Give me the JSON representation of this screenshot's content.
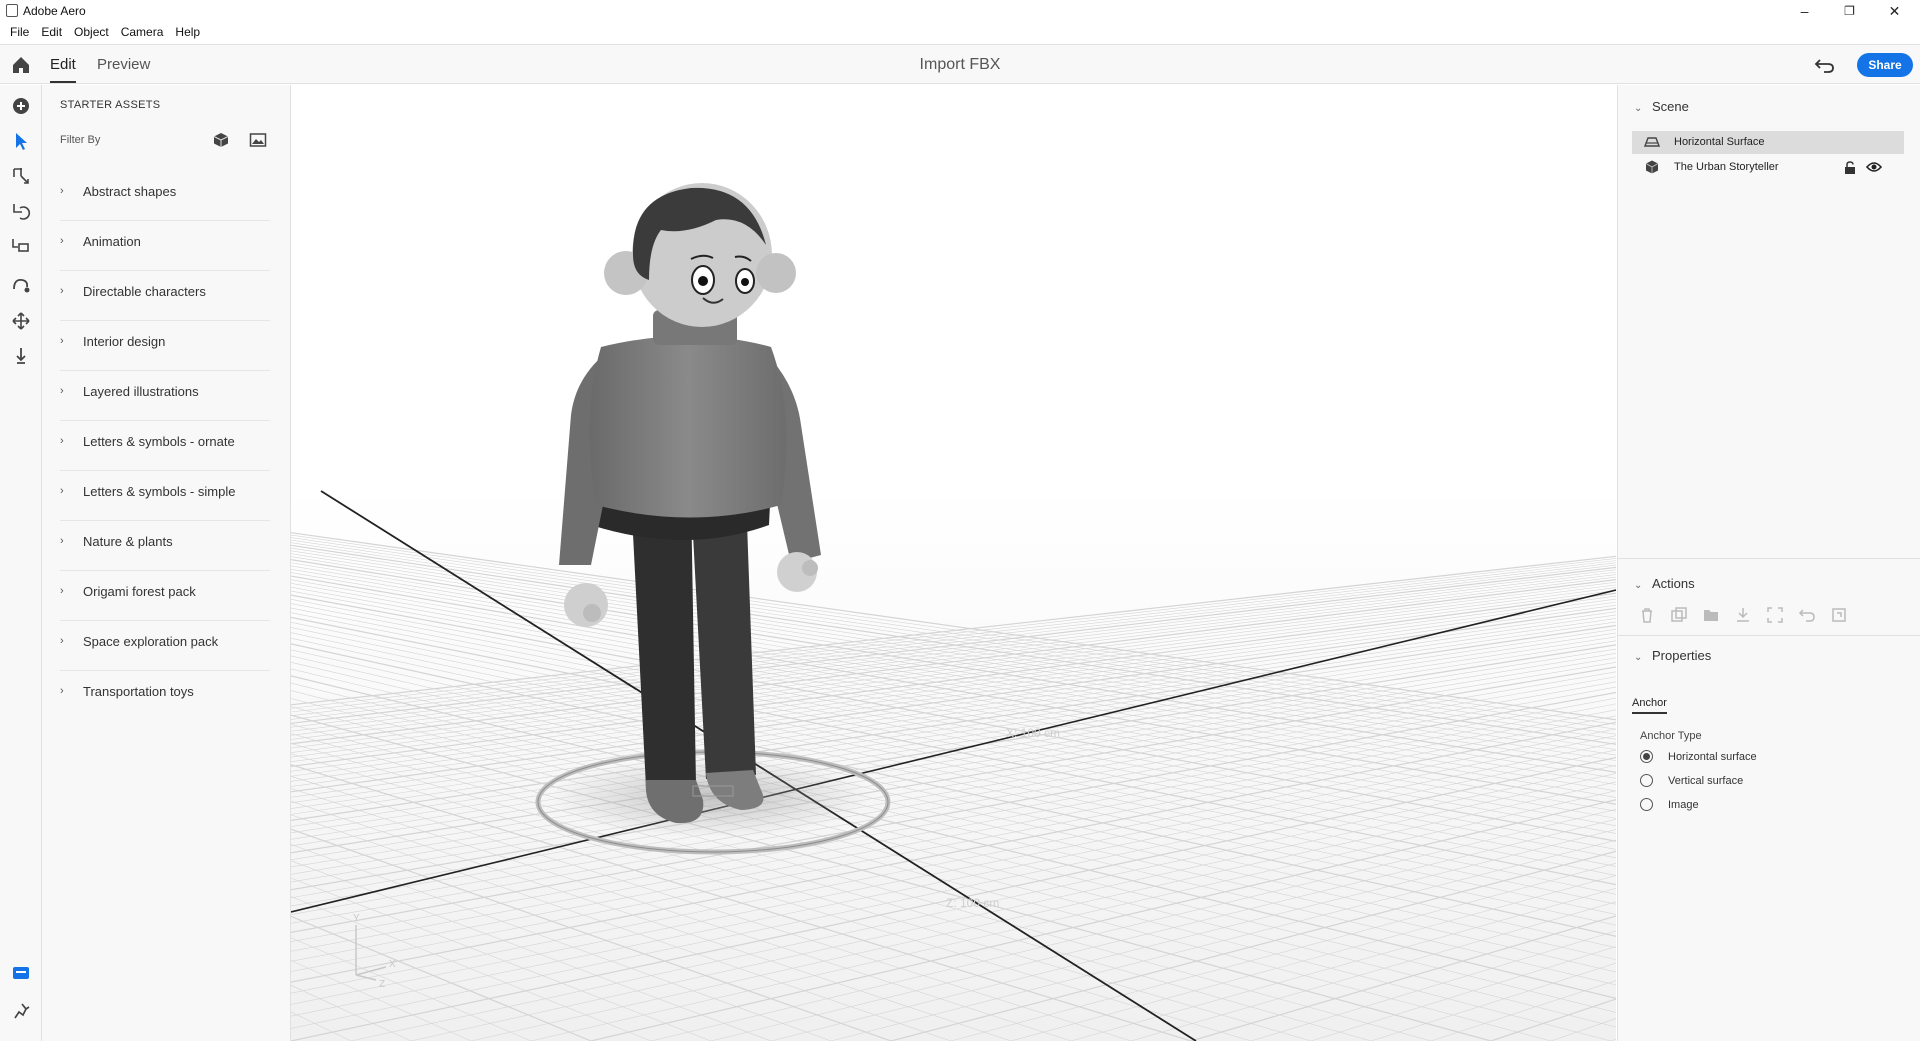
{
  "window": {
    "title": "Adobe Aero",
    "controls": {
      "minimize": "–",
      "restore": "❐",
      "close": "✕"
    }
  },
  "menu": [
    "File",
    "Edit",
    "Object",
    "Camera",
    "Help"
  ],
  "header": {
    "tabs": [
      "Edit",
      "Preview"
    ],
    "active_tab": "Edit",
    "document_title": "Import FBX",
    "share_label": "Share"
  },
  "toolrail": {
    "tools": [
      "add-icon",
      "select-icon",
      "move-icon",
      "rotate-icon",
      "scale-icon",
      "path-icon",
      "pan-icon",
      "drop-icon",
      "layers-icon",
      "behavior-icon"
    ]
  },
  "assets": {
    "heading": "STARTER ASSETS",
    "filter_label": "Filter By",
    "categories": [
      "Abstract shapes",
      "Animation",
      "Directable characters",
      "Interior design",
      "Layered illustrations",
      "Letters & symbols - ornate",
      "Letters & symbols - simple",
      "Nature & plants",
      "Origami forest pack",
      "Space exploration pack",
      "Transportation toys"
    ]
  },
  "viewport": {
    "dimension_x": "X: 100 cm",
    "dimension_z": "Z: 100 cm",
    "axis_labels": {
      "y": "Y",
      "x": "X",
      "z": "Z"
    }
  },
  "scene": {
    "heading": "Scene",
    "items": [
      {
        "label": "Horizontal Surface",
        "selected": true
      },
      {
        "label": "The Urban Storyteller",
        "selected": false
      }
    ]
  },
  "actions": {
    "heading": "Actions"
  },
  "properties": {
    "heading": "Properties",
    "tab": "Anchor",
    "anchor_type_label": "Anchor Type",
    "options": [
      "Horizontal surface",
      "Vertical surface",
      "Image"
    ],
    "selected_option": "Horizontal surface"
  },
  "colors": {
    "accent": "#1473e6",
    "panel": "#f8f8f8"
  }
}
